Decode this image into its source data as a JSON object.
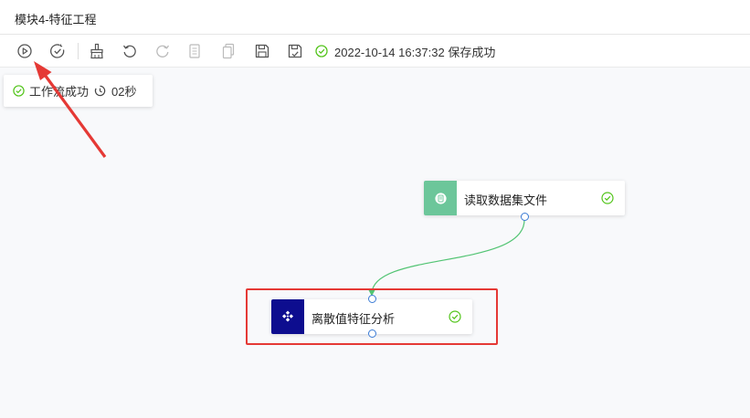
{
  "window": {
    "title": "模块4-特征工程"
  },
  "toolbar": {
    "buttons": [
      {
        "name": "run-icon"
      },
      {
        "name": "validate-icon"
      },
      {
        "name": "clear-brush-icon"
      },
      {
        "name": "undo-icon"
      },
      {
        "name": "redo-icon"
      },
      {
        "name": "copy-icon"
      },
      {
        "name": "paste-icon"
      },
      {
        "name": "save-icon"
      },
      {
        "name": "save-as-icon"
      }
    ],
    "save_time": "2022-10-14 16:37:32 保存成功"
  },
  "run_panel": {
    "status": "工作流成功",
    "duration": "02秒"
  },
  "nodes": [
    {
      "label": "读取数据集文件",
      "icon": "dataset-icon",
      "icon_color": "#6cc69a",
      "status": "success"
    },
    {
      "label": "离散值特征分析",
      "icon": "feature-analysis-icon",
      "icon_color": "#0d0d8f",
      "status": "success"
    }
  ],
  "colors": {
    "success": "#52c41a",
    "edge": "#52c473",
    "port": "#3a7bd5",
    "annotation": "#e53935"
  }
}
